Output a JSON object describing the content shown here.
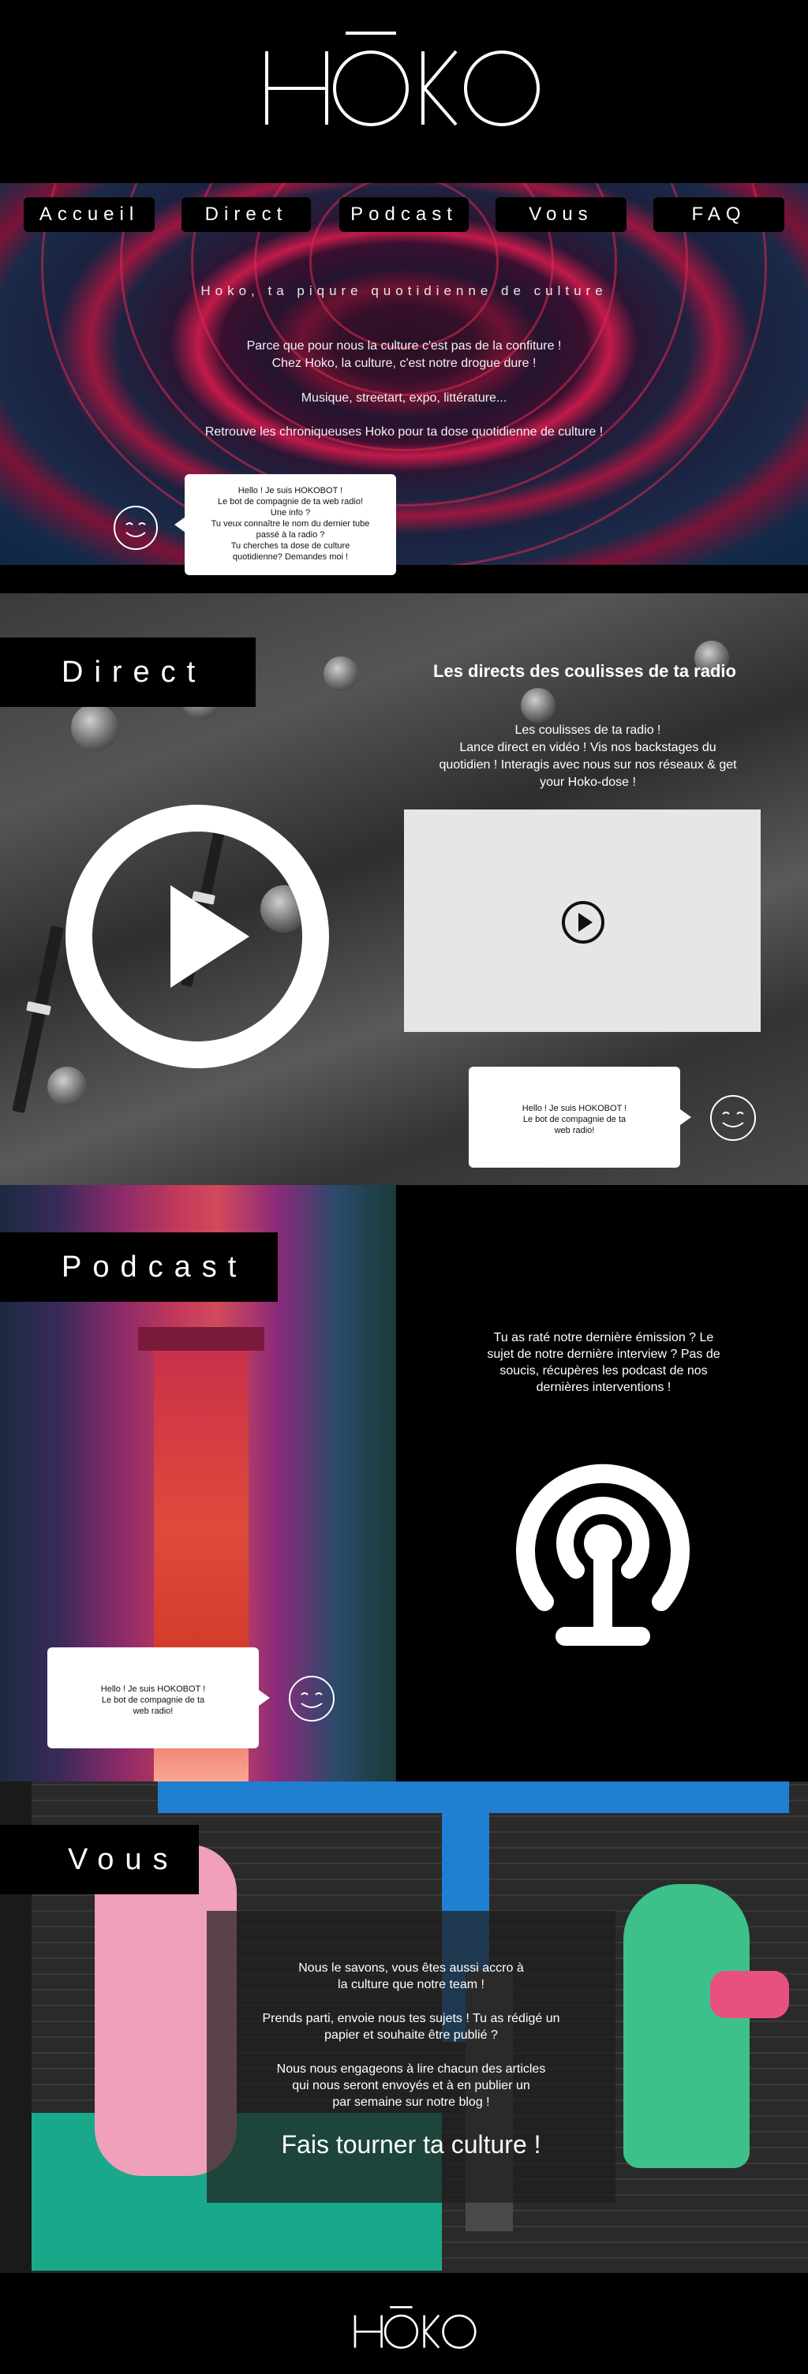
{
  "brand": {
    "logo_text": "HŌKO"
  },
  "nav": {
    "items": [
      {
        "label": "Accueil"
      },
      {
        "label": "Direct"
      },
      {
        "label": "Podcast"
      },
      {
        "label": "Vous"
      },
      {
        "label": "FAQ"
      }
    ]
  },
  "hero": {
    "title": "Hoko, ta piqure quotidienne de culture",
    "line1": "Parce que pour nous la culture c'est pas de la confiture !",
    "line2": "Chez Hoko, la culture, c'est notre drogue dure !",
    "line3": "Musique, streetart, expo, littérature...",
    "line4": "Retrouve les chroniqueuses Hoko pour ta dose quotidienne de culture !",
    "bot": {
      "l1": "Hello ! Je suis HOKOBOT !",
      "l2": "Le bot de compagnie de ta web radio!",
      "l3": "Une info ?",
      "l4": "Tu veux connaître le nom du dernier tube",
      "l5": "passé à la radio ?",
      "l6": "Tu cherches ta dose de culture",
      "l7": "quotidienne? Demandes moi !"
    }
  },
  "direct": {
    "label": "Direct",
    "title": "Les directs des coulisses de ta radio",
    "p1": "Les coulisses de ta radio !",
    "p2": "Lance direct en vidéo ! Vis nos backstages du",
    "p3": "quotidien ! Interagis avec nous sur nos réseaux & get",
    "p4": "your Hoko-dose !",
    "bot": {
      "l1": "Hello ! Je suis HOKOBOT !",
      "l2": "Le bot de compagnie de ta",
      "l3": "web radio!"
    }
  },
  "podcast": {
    "label": "Podcast",
    "p1": "Tu as raté notre dernière émission ? Le",
    "p2": "sujet de notre dernière interview ? Pas de",
    "p3": "soucis, récupères les podcast de nos",
    "p4": "dernières interventions !",
    "bot": {
      "l1": "Hello ! Je suis HOKOBOT !",
      "l2": "Le bot de compagnie de ta",
      "l3": "web radio!"
    }
  },
  "vous": {
    "label": "Vous",
    "p1a": "Nous le savons, vous êtes aussi accro à",
    "p1b": "la culture que notre team !",
    "p2a": "Prends parti, envoie nous tes sujets ! Tu as rédigé un",
    "p2b": "papier et souhaite être publié ?",
    "p3a": "Nous nous engageons à lire chacun des articles",
    "p3b": "qui nous seront envoyés et à en publier un",
    "p3c": "par semaine sur notre blog !",
    "cta": "Fais tourner ta culture !"
  },
  "icons": {
    "smiley": "smiley-icon",
    "play": "play-icon",
    "podcast": "podcast-icon"
  },
  "colors": {
    "background": "#000000",
    "text": "#ffffff",
    "hero_accent": "#c21a4a",
    "video_box": "#e6e6e6"
  }
}
